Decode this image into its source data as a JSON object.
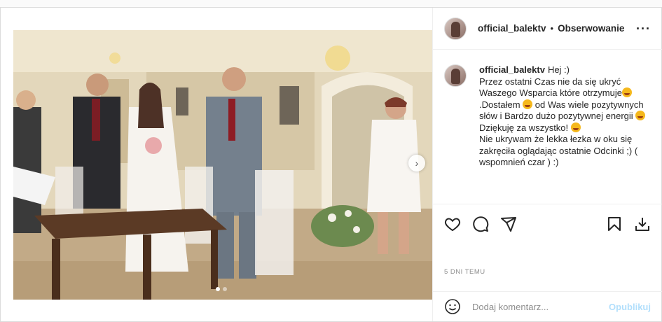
{
  "author": {
    "username": "official_balektv",
    "follow_status": "Obserwowanie",
    "separator": "•"
  },
  "icons": {
    "more": "more-options-icon",
    "like": "heart-icon",
    "comment": "comment-bubble-icon",
    "share": "paper-plane-icon",
    "save": "bookmark-icon",
    "download": "download-icon",
    "emoji": "smiley-icon",
    "next": "chevron-right-icon"
  },
  "caption": {
    "username": "official_balektv",
    "line1": "Hej :)",
    "line2": "Przez ostatni Czas nie da się ukryć Waszego Wsparcia które otrzymuje",
    "line3": ".Dostałem",
    "line3b": "od Was wiele pozytywnych słów i Bardzo dużo pozytywnej energii",
    "line4": "Dziękuję za wszystko!",
    "line5": "Nie ukrywam że lekka łezka w oku się zakręciła oglądając ostatnie Odcinki ;) ( wspomnień czar ) :)"
  },
  "post": {
    "date": "5 DNI TEMU",
    "carousel_total": 2,
    "carousel_active": 1
  },
  "comment_box": {
    "placeholder": "Dodaj komentarz...",
    "publish_label": "Opublikuj"
  },
  "colors": {
    "publish_disabled": "#b2dffc",
    "secondary_text": "#8e8e8e",
    "border": "#efefef"
  }
}
